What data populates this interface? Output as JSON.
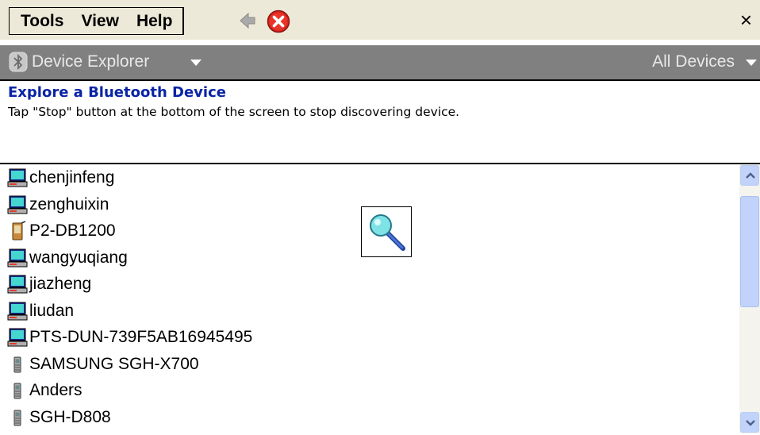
{
  "menubar": {
    "items": [
      {
        "label": "Tools"
      },
      {
        "label": "View"
      },
      {
        "label": "Help"
      }
    ],
    "back_icon": "back-arrow-icon",
    "stop_icon": "stop-icon",
    "close_label": "×"
  },
  "titlebar": {
    "icon": "bluetooth-icon",
    "title": "Device Explorer",
    "filter": "All Devices"
  },
  "header": {
    "heading": "Explore a Bluetooth Device",
    "instructions": "Tap \"Stop\" button at the bottom of the screen to stop discovering device."
  },
  "devices": [
    {
      "name": "chenjinfeng",
      "icon": "computer-icon"
    },
    {
      "name": "zenghuixin",
      "icon": "computer-icon"
    },
    {
      "name": "P2-DB1200",
      "icon": "pda-icon"
    },
    {
      "name": "wangyuqiang",
      "icon": "computer-icon"
    },
    {
      "name": "jiazheng",
      "icon": "computer-icon"
    },
    {
      "name": "liudan",
      "icon": "computer-icon"
    },
    {
      "name": "PTS-DUN-739F5AB16945495",
      "icon": "computer-icon"
    },
    {
      "name": "SAMSUNG SGH-X700",
      "icon": "phone-icon"
    },
    {
      "name": "Anders",
      "icon": "phone-icon"
    },
    {
      "name": "SGH-D808",
      "icon": "phone-icon"
    }
  ],
  "search_indicator_icon": "magnifier-icon",
  "colors": {
    "menu_bg": "#ece9d8",
    "title_bg": "#808080",
    "heading": "#0a24a5",
    "scrollbar": "#c1d3fb"
  }
}
